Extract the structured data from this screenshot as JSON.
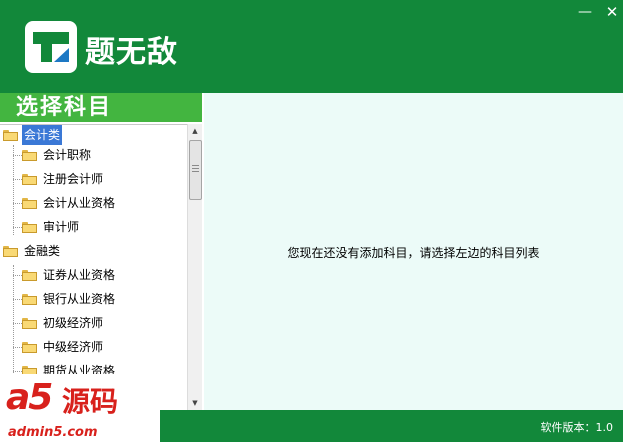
{
  "app": {
    "title": "题无敌",
    "minimize_glyph": "—",
    "close_glyph": "✕"
  },
  "sidebar": {
    "title": "选择科目",
    "tree": [
      {
        "label": "会计类",
        "selected": true,
        "children": [
          "会计职称",
          "注册会计师",
          "会计从业资格",
          "审计师"
        ]
      },
      {
        "label": "金融类",
        "selected": false,
        "children": [
          "证券从业资格",
          "银行从业资格",
          "初级经济师",
          "中级经济师",
          "期货从业资格"
        ]
      }
    ]
  },
  "main": {
    "empty_message": "您现在还没有添加科目，请选择左边的科目列表"
  },
  "footer": {
    "version": "软件版本：1.0"
  },
  "watermark": {
    "brand": "a5",
    "brand_cn": "源码",
    "url": "admin5.com"
  },
  "colors": {
    "brand_green": "#12883a",
    "title_bar_green": "#43b540",
    "content_bg": "#ecfbf8",
    "selection_blue": "#3a78d6"
  }
}
